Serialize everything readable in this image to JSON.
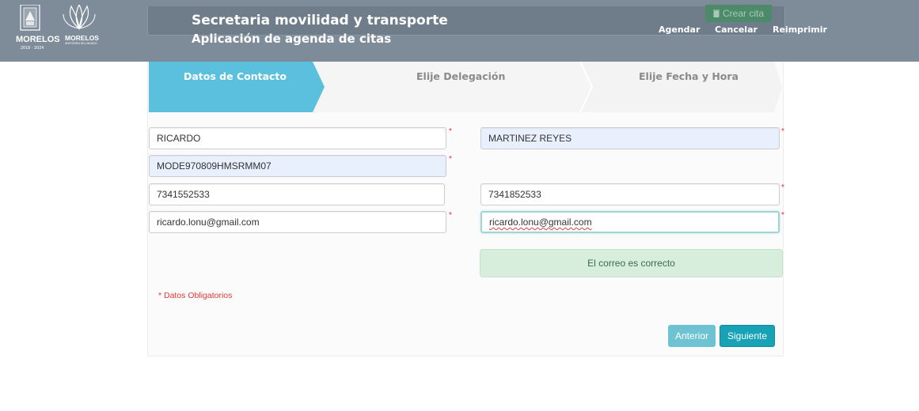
{
  "colors": {
    "header_bg": "#7e8c9a",
    "step_active": "#5bc0de",
    "required": "#e03030",
    "success_bg": "#d8eedc",
    "primary_button": "#17a2b8"
  },
  "header": {
    "logo_left_text": "MORELOS",
    "logo_left_years": "2018 - 2024",
    "logo_right_text": "MORELOS",
    "logo_right_sub": "ANFITRIÓN DEL MUNDO",
    "title": "Secretaria movilidad y transporte",
    "subtitle": "Aplicación de agenda de citas",
    "crear_cita": "Crear cita",
    "nav": [
      "Agendar",
      "Cancelar",
      "Reimprimir"
    ]
  },
  "steps": [
    {
      "label": "Datos de Contacto",
      "active": true
    },
    {
      "label": "Elije Delegación",
      "active": false
    },
    {
      "label": "Elije Fecha y Hora",
      "active": false
    }
  ],
  "form": {
    "nombre": "RICARDO",
    "apellidos": "MARTINEZ REYES",
    "curp": "MODE970809HMSRMM07",
    "telefono": "7341552533",
    "telefono2": "7341852533",
    "correo": "ricardo.lonu@gmail.com",
    "correo_confirm": "ricardo.lonu@gmail.com",
    "required_mark": "*"
  },
  "alert": "El correo es correcto",
  "obligatorios": "* Datos Obligatorios",
  "buttons": {
    "anterior": "Anterior",
    "siguiente": "Siguiente"
  }
}
